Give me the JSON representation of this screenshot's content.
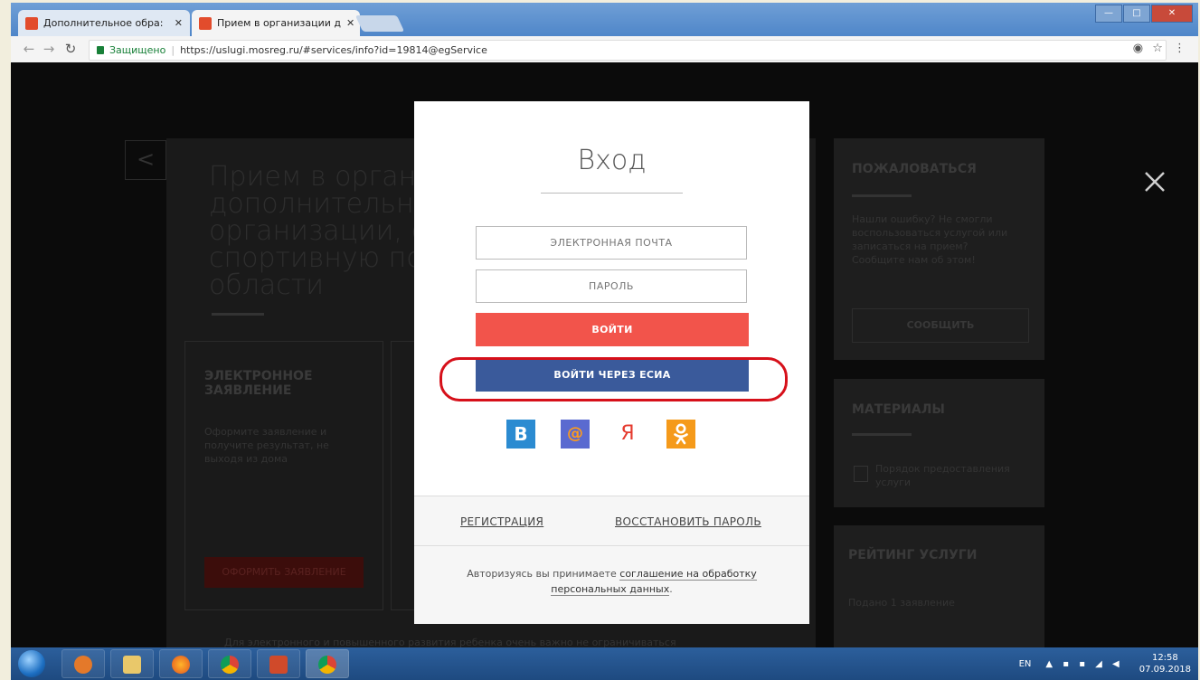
{
  "browser": {
    "tabs": [
      {
        "title": "Дополнительное обра:",
        "close": "✕"
      },
      {
        "title": "Прием в организации д",
        "close": "✕"
      }
    ],
    "address": {
      "secure_label": "Защищено",
      "url": "https://uslugi.mosreg.ru/#services/info?id=19814@egService"
    }
  },
  "background": {
    "title_lines": [
      "Прием в органи",
      "дополнительно",
      "организации, ос",
      "спортивную под",
      "области"
    ],
    "card1": {
      "heading": "ЭЛЕКТРОННОЕ ЗАЯВЛЕНИЕ",
      "text": "Оформите заявление и получите результат, не выходя из дома",
      "button": "ОФОРМИТЬ ЗАЯВЛЕНИЕ"
    },
    "side": {
      "complain_title": "ПОЖАЛОВАТЬСЯ",
      "complain_text": "Нашли ошибку? Не смогли воспользоваться услугой или записаться на прием? Сообщите нам об этом!",
      "report_button": "СООБЩИТЬ",
      "materials_title": "МАТЕРИАЛЫ",
      "materials_item": "Порядок предоставления услуги",
      "rating_title": "РЕЙТИНГ УСЛУГИ",
      "rating_text": "Подано 1 заявление"
    },
    "bottom_text": "Для электронного и повышенного развития ребенка очень важно не ограничиваться"
  },
  "login": {
    "title": "Вход",
    "email_placeholder": "ЭЛЕКТРОННАЯ ПОЧТА",
    "password_placeholder": "ПАРОЛЬ",
    "login_button": "ВОЙТИ",
    "esia_button": "ВОЙТИ ЧЕРЕЗ ЕСИА",
    "social": {
      "vk": "В",
      "mail": "@",
      "yandex": "Я",
      "ok": "ок"
    },
    "register_link": "РЕГИСТРАЦИЯ",
    "restore_link": "ВОССТАНОВИТЬ ПАРОЛЬ",
    "agreement_prefix": "Авторизуясь вы принимаете ",
    "agreement_link": "соглашение на обработку персональных данных",
    "agreement_suffix": "."
  },
  "taskbar": {
    "lang": "EN",
    "time": "12:58",
    "date": "07.09.2018"
  },
  "colors": {
    "login_red": "#f2544b",
    "esia_blue": "#3a5a9b",
    "highlight_red": "#d6101a"
  }
}
